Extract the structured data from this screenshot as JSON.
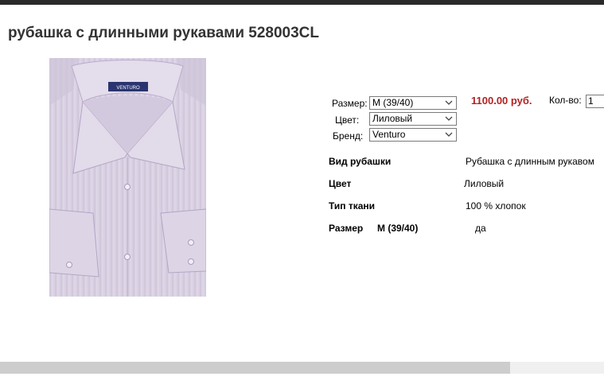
{
  "product": {
    "title": "рубашка с длинными рукавами 528003CL",
    "image_label": "VENTURO"
  },
  "options": {
    "size_label": "Размер:",
    "size_value": "M (39/40)",
    "color_label": "Цвет:",
    "color_value": "Лиловый",
    "brand_label": "Бренд:",
    "brand_value": "Venturo"
  },
  "purchase": {
    "price": "1100.00 руб.",
    "qty_label": "Кол-во:",
    "qty_value": "1"
  },
  "specs": {
    "type_label": "Вид рубашки",
    "type_value": "Рубашка с длинным рукавом",
    "color_label": "Цвет",
    "color_value": "Лиловый",
    "fabric_label": "Тип ткани",
    "fabric_value": "100 % хлопок",
    "size_label": "Размер",
    "size_option": "M (39/40)",
    "size_value": "да"
  },
  "colors": {
    "price": "#b22222",
    "title": "#333333",
    "shirt": "#d7cfe0"
  }
}
